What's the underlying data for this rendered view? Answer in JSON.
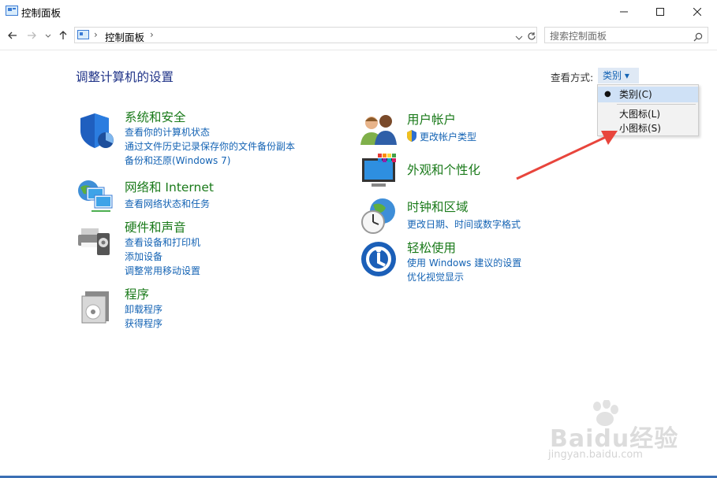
{
  "window": {
    "title": "控制面板"
  },
  "nav": {
    "breadcrumb_sep": "›",
    "breadcrumb_item": "控制面板",
    "search_placeholder": "搜索控制面板"
  },
  "main": {
    "page_title": "调整计算机的设置",
    "view_by_label": "查看方式:",
    "view_by_value": "类别 ▾"
  },
  "dropdown": {
    "items": [
      {
        "label": "类别(C)",
        "selected": true
      },
      {
        "label": "大图标(L)",
        "selected": false
      },
      {
        "label": "小图标(S)",
        "selected": false
      }
    ]
  },
  "categories": {
    "system": {
      "title": "系统和安全",
      "links": [
        "查看你的计算机状态",
        "通过文件历史记录保存你的文件备份副本",
        "备份和还原(Windows 7)"
      ]
    },
    "network": {
      "title": "网络和 Internet",
      "links": [
        "查看网络状态和任务"
      ]
    },
    "hardware": {
      "title": "硬件和声音",
      "links": [
        "查看设备和打印机",
        "添加设备",
        "调整常用移动设置"
      ]
    },
    "programs": {
      "title": "程序",
      "links": [
        "卸载程序",
        "获得程序"
      ]
    },
    "users": {
      "title": "用户帐户",
      "links": [
        "更改帐户类型"
      ]
    },
    "appearance": {
      "title": "外观和个性化",
      "links": []
    },
    "clock": {
      "title": "时钟和区域",
      "links": [
        "更改日期、时间或数字格式"
      ]
    },
    "ease": {
      "title": "轻松使用",
      "links": [
        "使用 Windows 建议的设置",
        "优化视觉显示"
      ]
    }
  },
  "watermark": {
    "text": "Baidu经验",
    "sub": "jingyan.baidu.com"
  },
  "colors": {
    "link": "#1463b4",
    "category_title": "#1a7a1a",
    "page_title": "#1e3287",
    "arrow": "#e8453c"
  }
}
